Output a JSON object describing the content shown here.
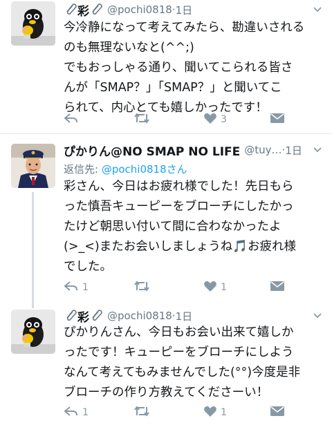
{
  "tweets": [
    {
      "name": "彩",
      "handle": "@pochi0818",
      "sep": "·",
      "time": "1日",
      "lines": [
        "今冷静になって考えてみたら、勘違いされる",
        "のも無理ないなと(^^;)",
        "でもおっしゃる通り、聞いてこられる皆さ",
        "んが「SMAP？」「SMAP？」と聞いてこ",
        "られて、内心とても嬉しかったです！"
      ],
      "reply_count": "",
      "retweet_count": "",
      "like_count": "3"
    },
    {
      "name": "ぴかりん@NO SMAP NO LIFE",
      "handle": "@tuy…",
      "sep": "·",
      "time": "1日",
      "reply_label": "返信先:",
      "reply_to": "@pochi0818さん",
      "lines": [
        "彩さん、今日はお疲れ様でした！先日もら",
        "った慎吾キューピーをブローチにしたかっ",
        "たけど朝思い付いて間に合わなかったよ",
        "(>_<)またお会いしましょうね🎵お疲れ様",
        "でした。"
      ],
      "reply_count": "1",
      "retweet_count": "",
      "like_count": "1"
    },
    {
      "name": "彩",
      "handle": "@pochi0818",
      "sep": "·",
      "time": "1日",
      "lines": [
        "ぴかりんさん、今日もお会い出来て嬉しか",
        "ったです！キューピーをブローチにしよう",
        "なんて考えてもみませんでした(°°)今度是非",
        "ブローチの作り方教えてくださーい！"
      ],
      "reply_count": "1",
      "retweet_count": "",
      "like_count": "1"
    }
  ],
  "colors": {
    "meta": "#657786",
    "link": "#1da1f2",
    "icon": "#8899a6",
    "divider": "#e1e8ed"
  },
  "icons": [
    "paperclip-icon",
    "chevron-down-icon",
    "reply-icon",
    "retweet-icon",
    "like-icon",
    "dm-icon"
  ]
}
